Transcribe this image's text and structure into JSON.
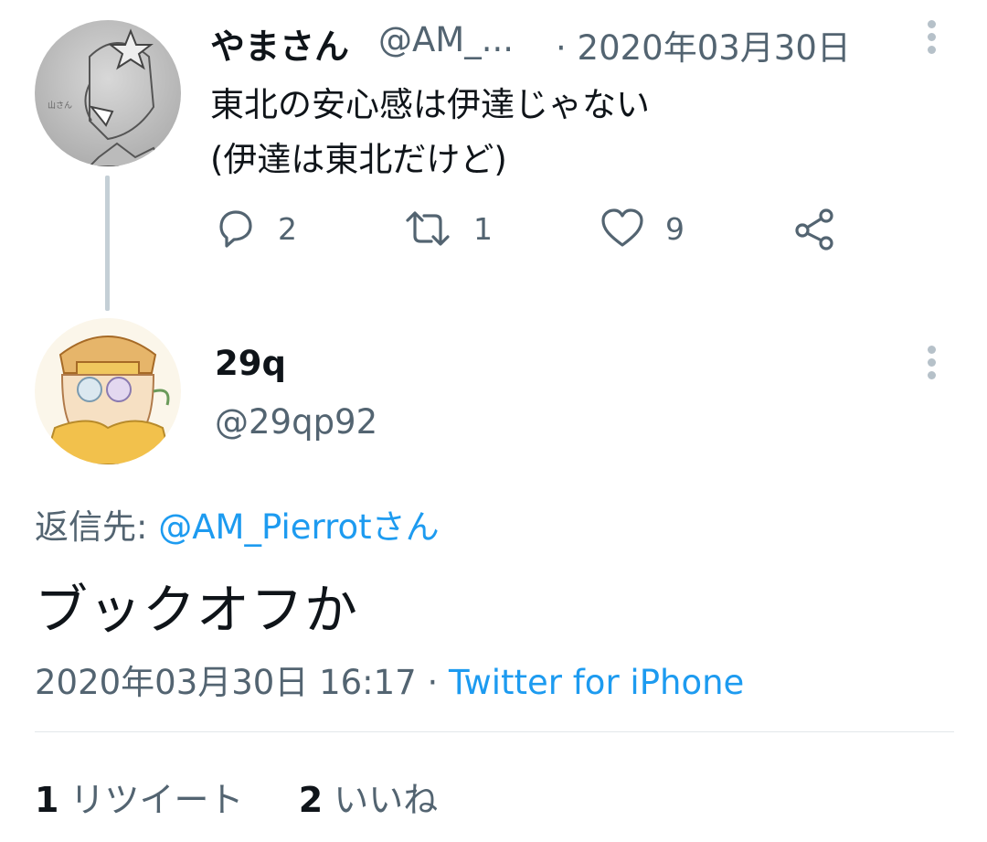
{
  "parent_tweet": {
    "display_name": "やまさん",
    "handle": "@AM_...",
    "separator": "·",
    "date": "2020年03月30日",
    "lines": [
      "東北の安心感は伊達じゃない",
      "(伊達は東北だけど)"
    ],
    "actions": {
      "replies": "2",
      "retweets": "1",
      "likes": "9"
    },
    "icons": [
      "reply-icon",
      "retweet-icon",
      "like-icon",
      "share-icon",
      "more-icon"
    ]
  },
  "main_tweet": {
    "display_name": "29q",
    "handle": "@29qp92",
    "reply_prefix": "返信先: ",
    "reply_target": "@AM_Pierrotさん",
    "text": "ブックオフか",
    "timestamp": "2020年03月30日 16:17",
    "meta_separator": " · ",
    "source": "Twitter for iPhone"
  },
  "stats": {
    "retweet_count": "1",
    "retweet_label": "リツイート",
    "like_count": "2",
    "like_label": "いいね"
  },
  "colors": {
    "accent": "#1d9bf0",
    "muted": "#536471",
    "thread_line": "#c4cfd6"
  }
}
